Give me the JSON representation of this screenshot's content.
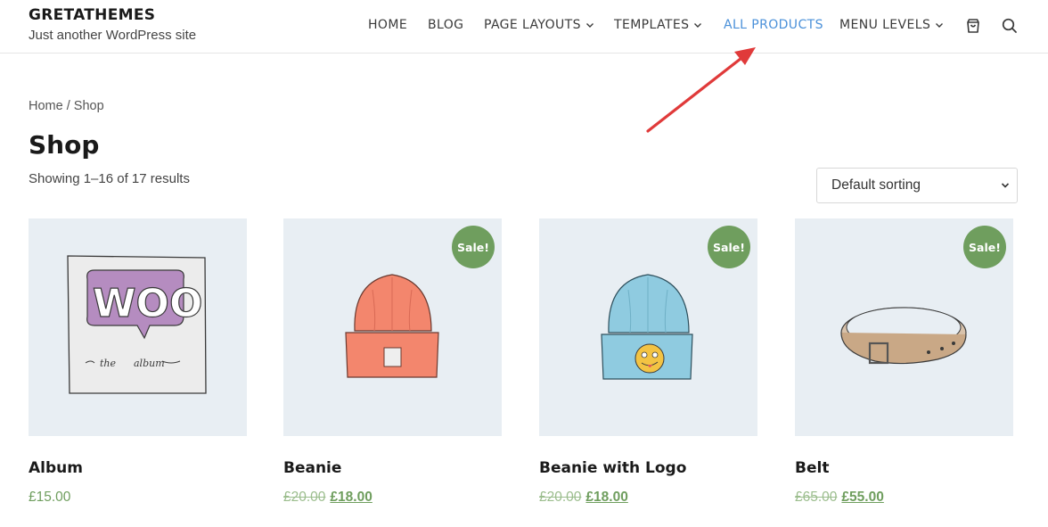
{
  "site": {
    "title": "GRETATHEMES",
    "tagline": "Just another WordPress site"
  },
  "nav": {
    "items": [
      {
        "label": "HOME"
      },
      {
        "label": "BLOG"
      },
      {
        "label": "PAGE LAYOUTS",
        "has_dropdown": true
      },
      {
        "label": "TEMPLATES",
        "has_dropdown": true
      },
      {
        "label": "ALL PRODUCTS",
        "active": true
      },
      {
        "label": "MENU LEVELS",
        "has_dropdown": true
      }
    ],
    "cart_icon": "cart-icon",
    "search_icon": "search-icon",
    "active_color": "#4a90d9"
  },
  "annotation": {
    "arrow_color": "#e03a3a",
    "arrow_points_to": "ALL PRODUCTS"
  },
  "breadcrumb": {
    "home": "Home",
    "separator": " / ",
    "current": "Shop"
  },
  "page": {
    "title": "Shop",
    "result_count": "Showing 1–16 of 17 results"
  },
  "sorting": {
    "selected": "Default sorting"
  },
  "colors": {
    "sale_badge": "#6f9e5e",
    "price": "#6f9e5e",
    "image_bg": "#e8eef3"
  },
  "products": [
    {
      "name": "Album",
      "price": "£15.00",
      "on_sale": false,
      "image": "woo-album-art"
    },
    {
      "name": "Beanie",
      "old_price": "£20.00",
      "price": "£18.00",
      "on_sale": true,
      "sale_label": "Sale!",
      "image": "orange-beanie"
    },
    {
      "name": "Beanie with Logo",
      "old_price": "£20.00",
      "price": "£18.00",
      "on_sale": true,
      "sale_label": "Sale!",
      "image": "blue-beanie-with-emoji"
    },
    {
      "name": "Belt",
      "old_price": "£65.00",
      "price": "£55.00",
      "on_sale": true,
      "sale_label": "Sale!",
      "image": "leather-belt"
    }
  ]
}
